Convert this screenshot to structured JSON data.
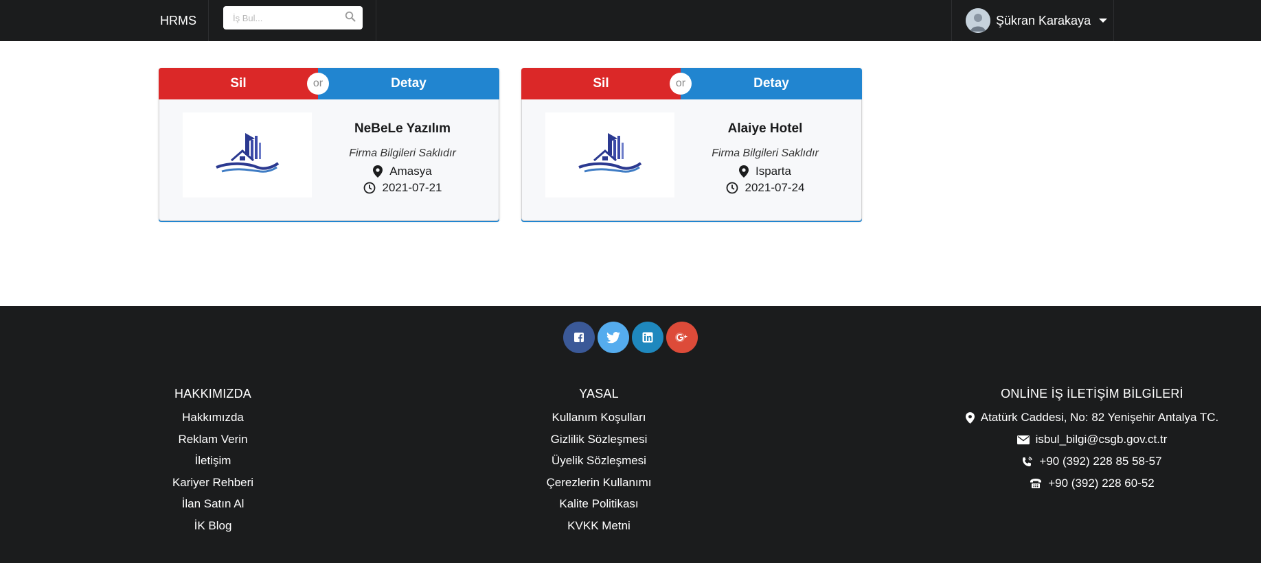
{
  "navbar": {
    "brand": "HRMS",
    "search_placeholder": "İş Bul...",
    "user_name": "Şükran Karakaya"
  },
  "cards": [
    {
      "delete_label": "Sil",
      "or_label": "or",
      "detail_label": "Detay",
      "company_name": "NeBeLe Yazılım",
      "description": "Firma Bilgileri Saklıdır",
      "city": "Amasya",
      "date": "2021-07-21"
    },
    {
      "delete_label": "Sil",
      "or_label": "or",
      "detail_label": "Detay",
      "company_name": "Alaiye Hotel",
      "description": "Firma Bilgileri Saklıdır",
      "city": "Isparta",
      "date": "2021-07-24"
    }
  ],
  "social": [
    "facebook-icon",
    "twitter-icon",
    "linkedin-icon",
    "google-plus-icon"
  ],
  "footer": {
    "about": {
      "title": "HAKKIMIZDA",
      "links": [
        "Hakkımızda",
        "Reklam Verin",
        "İletişim",
        "Kariyer Rehberi",
        "İlan Satın Al",
        "İK Blog"
      ]
    },
    "legal": {
      "title": "YASAL",
      "links": [
        "Kullanım Koşulları",
        "Gizlilik Sözleşmesi",
        "Üyelik Sözleşmesi",
        "Çerezlerin Kullanımı",
        "Kalite Politikası",
        "KVKK Metni"
      ]
    },
    "contact": {
      "title": "ONLİNE İŞ İLETİŞİM BİLGİLERİ",
      "address": "Atatürk Caddesi, No: 82 Yenişehir Antalya TC.",
      "email": "isbul_bilgi@csgb.gov.ct.tr",
      "phone": "+90 (392) 228 85 58-57",
      "fax": "+90 (392) 228 60-52"
    }
  },
  "colors": {
    "navbar_bg": "#1b1c1d",
    "delete": "#db2828",
    "detail": "#2185d0",
    "facebook": "#3b5998",
    "twitter": "#55acee",
    "linkedin": "#1f88be",
    "google_plus": "#dd4b39"
  }
}
